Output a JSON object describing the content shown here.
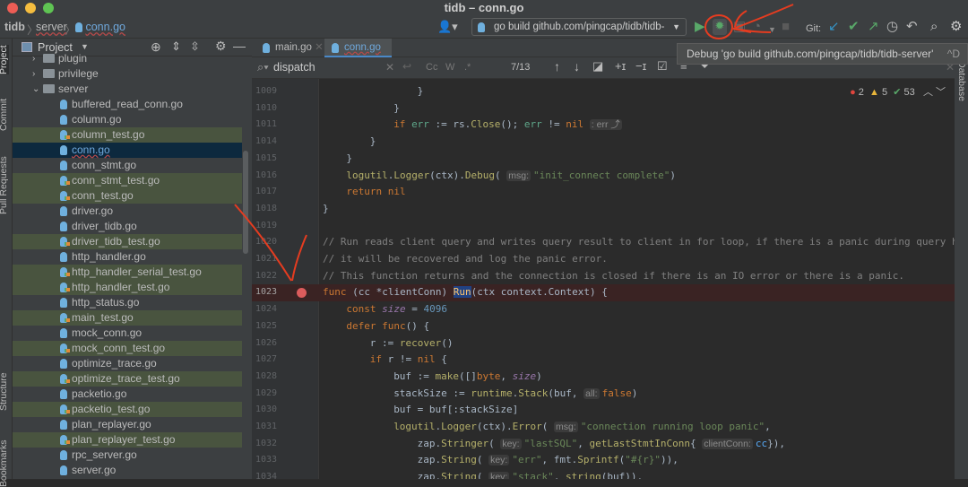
{
  "window": {
    "title": "tidb – conn.go"
  },
  "breadcrumb": [
    "tidb",
    "server",
    "conn.go"
  ],
  "toolbar": {
    "run_config": "go build github.com/pingcap/tidb/tidb-server",
    "git_label": "Git:",
    "icons": [
      "user-icon",
      "run-icon",
      "debug-icon",
      "coverage-icon",
      "profile-icon",
      "stop-icon",
      "git-update-icon",
      "git-commit-icon",
      "git-push-icon",
      "history-icon",
      "rollback-icon",
      "search-icon",
      "settings-icon"
    ],
    "colors": {
      "run": "#59a869",
      "debug": "#59a869",
      "git_update": "#3592c4",
      "annotation": "#e53c20"
    }
  },
  "tooltip": {
    "text": "Debug 'go build github.com/pingcap/tidb/tidb-server'",
    "shortcut": "^D"
  },
  "side_tools": {
    "left": [
      "Project",
      "Commit",
      "Pull Requests",
      "Structure",
      "Bookmarks"
    ],
    "right": [
      "Database"
    ]
  },
  "project": {
    "title": "Project",
    "tree": [
      {
        "label": "plugin",
        "kind": "folder",
        "open": false
      },
      {
        "label": "privilege",
        "kind": "folder",
        "open": false
      },
      {
        "label": "server",
        "kind": "folder",
        "open": true
      },
      {
        "label": "buffered_read_conn.go",
        "kind": "file"
      },
      {
        "label": "column.go",
        "kind": "file"
      },
      {
        "label": "column_test.go",
        "kind": "test"
      },
      {
        "label": "conn.go",
        "kind": "file",
        "selected": true
      },
      {
        "label": "conn_stmt.go",
        "kind": "file"
      },
      {
        "label": "conn_stmt_test.go",
        "kind": "test"
      },
      {
        "label": "conn_test.go",
        "kind": "test"
      },
      {
        "label": "driver.go",
        "kind": "file"
      },
      {
        "label": "driver_tidb.go",
        "kind": "file"
      },
      {
        "label": "driver_tidb_test.go",
        "kind": "test"
      },
      {
        "label": "http_handler.go",
        "kind": "file"
      },
      {
        "label": "http_handler_serial_test.go",
        "kind": "test"
      },
      {
        "label": "http_handler_test.go",
        "kind": "test"
      },
      {
        "label": "http_status.go",
        "kind": "file"
      },
      {
        "label": "main_test.go",
        "kind": "test"
      },
      {
        "label": "mock_conn.go",
        "kind": "file"
      },
      {
        "label": "mock_conn_test.go",
        "kind": "test"
      },
      {
        "label": "optimize_trace.go",
        "kind": "file"
      },
      {
        "label": "optimize_trace_test.go",
        "kind": "test"
      },
      {
        "label": "packetio.go",
        "kind": "file"
      },
      {
        "label": "packetio_test.go",
        "kind": "test"
      },
      {
        "label": "plan_replayer.go",
        "kind": "file"
      },
      {
        "label": "plan_replayer_test.go",
        "kind": "test"
      },
      {
        "label": "rpc_server.go",
        "kind": "file"
      },
      {
        "label": "server.go",
        "kind": "file"
      }
    ]
  },
  "tabs": [
    {
      "label": "main.go",
      "active": false
    },
    {
      "label": "conn.go",
      "active": true
    }
  ],
  "search": {
    "query": "dispatch",
    "match": "7/13",
    "options": [
      "Cc",
      "W",
      ".*"
    ]
  },
  "inspections": {
    "errors": "2",
    "warnings": "5",
    "ok": "53"
  },
  "code": [
    {
      "n": "1009",
      "i": 4,
      "t": [
        [
          "p",
          "}"
        ]
      ]
    },
    {
      "n": "1010",
      "i": 3,
      "t": [
        [
          "p",
          "}"
        ]
      ]
    },
    {
      "n": "1011",
      "i": 3,
      "t": [
        [
          "kw",
          "if "
        ],
        [
          "grn",
          "err"
        ],
        [
          "p",
          " := rs."
        ],
        [
          "fn",
          "Close"
        ],
        [
          "p",
          "(); "
        ],
        [
          "grn",
          "err"
        ],
        [
          "p",
          " != "
        ],
        [
          "kw",
          "nil "
        ],
        [
          "hint",
          ": err ⤴"
        ]
      ]
    },
    {
      "n": "1014",
      "i": 2,
      "t": [
        [
          "p",
          "}"
        ]
      ]
    },
    {
      "n": "1015",
      "i": 1,
      "t": [
        [
          "p",
          "}"
        ]
      ]
    },
    {
      "n": "1016",
      "i": 1,
      "t": [
        [
          "fn",
          "logutil"
        ],
        [
          "p",
          "."
        ],
        [
          "fn",
          "Logger"
        ],
        [
          "p",
          "(ctx)."
        ],
        [
          "fn",
          "Debug"
        ],
        [
          "p",
          "( "
        ],
        [
          "hint",
          "msg:"
        ],
        [
          "str",
          "\"init_connect complete\""
        ],
        [
          "p",
          ")"
        ]
      ]
    },
    {
      "n": "1017",
      "i": 1,
      "t": [
        [
          "kw",
          "return nil"
        ]
      ]
    },
    {
      "n": "1018",
      "i": 0,
      "t": [
        [
          "p",
          "}"
        ]
      ]
    },
    {
      "n": "1019",
      "i": 0,
      "t": []
    },
    {
      "n": "1020",
      "i": 0,
      "t": [
        [
          "cmt",
          "// Run reads client query and writes query result to client in for loop, if there is a panic during query handling,"
        ]
      ]
    },
    {
      "n": "1021",
      "i": 0,
      "t": [
        [
          "cmt",
          "// it will be recovered and log the panic error."
        ]
      ]
    },
    {
      "n": "1022",
      "i": 0,
      "t": [
        [
          "cmt",
          "// This function returns and the connection is closed if there is an IO error or there is a panic."
        ]
      ]
    },
    {
      "n": "1023",
      "i": 0,
      "bp": true,
      "t": [
        [
          "kw",
          "func"
        ],
        [
          "p",
          " (cc *clientConn) "
        ],
        [
          "sel",
          "Run"
        ],
        [
          "p",
          "(ctx context.Context) {"
        ]
      ]
    },
    {
      "n": "1024",
      "i": 1,
      "t": [
        [
          "kw",
          "const "
        ],
        [
          "var",
          "size"
        ],
        [
          "p",
          " = "
        ],
        [
          "num",
          "4096"
        ]
      ]
    },
    {
      "n": "1025",
      "i": 1,
      "t": [
        [
          "kw",
          "defer func"
        ],
        [
          "p",
          "() {"
        ]
      ]
    },
    {
      "n": "1026",
      "i": 2,
      "t": [
        [
          "p",
          "r := "
        ],
        [
          "fn",
          "recover"
        ],
        [
          "p",
          "()"
        ]
      ]
    },
    {
      "n": "1027",
      "i": 2,
      "t": [
        [
          "kw",
          "if"
        ],
        [
          "p",
          " r != "
        ],
        [
          "kw",
          "nil"
        ],
        [
          "p",
          " {"
        ]
      ]
    },
    {
      "n": "1028",
      "i": 3,
      "t": [
        [
          "p",
          "buf := "
        ],
        [
          "fn",
          "make"
        ],
        [
          "p",
          "([]"
        ],
        [
          "kw",
          "byte"
        ],
        [
          "p",
          ", "
        ],
        [
          "var",
          "size"
        ],
        [
          "p",
          ")"
        ]
      ]
    },
    {
      "n": "1029",
      "i": 3,
      "t": [
        [
          "p",
          "stackSize := "
        ],
        [
          "fn",
          "runtime"
        ],
        [
          "p",
          "."
        ],
        [
          "fn",
          "Stack"
        ],
        [
          "p",
          "(buf, "
        ],
        [
          "hint",
          "all:"
        ],
        [
          "kw",
          "false"
        ],
        [
          "p",
          ")"
        ]
      ]
    },
    {
      "n": "1030",
      "i": 3,
      "t": [
        [
          "p",
          "buf = buf[:stackSize]"
        ]
      ]
    },
    {
      "n": "1031",
      "i": 3,
      "t": [
        [
          "fn",
          "logutil"
        ],
        [
          "p",
          "."
        ],
        [
          "fn",
          "Logger"
        ],
        [
          "p",
          "(ctx)."
        ],
        [
          "fn",
          "Error"
        ],
        [
          "p",
          "( "
        ],
        [
          "hint",
          "msg:"
        ],
        [
          "str",
          "\"connection running loop panic\""
        ],
        [
          "p",
          ","
        ]
      ]
    },
    {
      "n": "1032",
      "i": 4,
      "t": [
        [
          "p",
          "zap."
        ],
        [
          "fn",
          "Stringer"
        ],
        [
          "p",
          "( "
        ],
        [
          "hint",
          "key:"
        ],
        [
          "str",
          "\"lastSQL\""
        ],
        [
          "p",
          ", "
        ],
        [
          "fn",
          "getLastStmtInConn"
        ],
        [
          "p",
          "{ "
        ],
        [
          "hint",
          "clientConn:"
        ],
        [
          "blue",
          "cc"
        ],
        [
          "p",
          "}),"
        ]
      ]
    },
    {
      "n": "1033",
      "i": 4,
      "t": [
        [
          "p",
          "zap."
        ],
        [
          "fn",
          "String"
        ],
        [
          "p",
          "( "
        ],
        [
          "hint",
          "key:"
        ],
        [
          "str",
          "\"err\""
        ],
        [
          "p",
          ", fmt."
        ],
        [
          "fn",
          "Sprintf"
        ],
        [
          "p",
          "("
        ],
        [
          "str",
          "\"#{r}\""
        ],
        [
          "p",
          ")),"
        ]
      ]
    },
    {
      "n": "1034",
      "i": 4,
      "t": [
        [
          "p",
          "zap."
        ],
        [
          "fn",
          "String"
        ],
        [
          "p",
          "( "
        ],
        [
          "hint",
          "key:"
        ],
        [
          "str",
          "\"stack\""
        ],
        [
          "p",
          ", "
        ],
        [
          "fn",
          "string"
        ],
        [
          "p",
          "(buf)),"
        ]
      ]
    }
  ]
}
